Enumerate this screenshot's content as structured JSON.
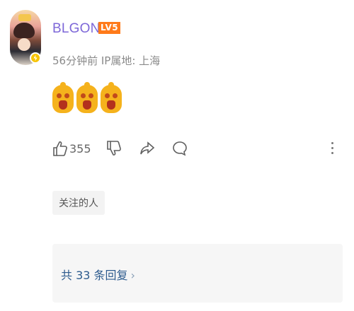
{
  "comment": {
    "username": "BLGON",
    "level_badge": "LV5",
    "meta": "56分钟前 IP属地: 上海",
    "emojis": [
      "emoji-shocked",
      "emoji-shocked",
      "emoji-shocked"
    ],
    "likes": "355",
    "tag": "关注的人",
    "replies_label": "共 33 条回复",
    "replies_chevron": "›"
  },
  "colors": {
    "username": "#7d67d8",
    "level_badge": "#ff7a1a",
    "link": "#2d5b8e",
    "verified": "#f7c400"
  },
  "icons": {
    "like": "thumbs-up-icon",
    "dislike": "thumbs-down-icon",
    "share": "share-icon",
    "reply": "comment-icon",
    "more": "more-vertical-icon",
    "verified": "verified-badge-icon"
  }
}
